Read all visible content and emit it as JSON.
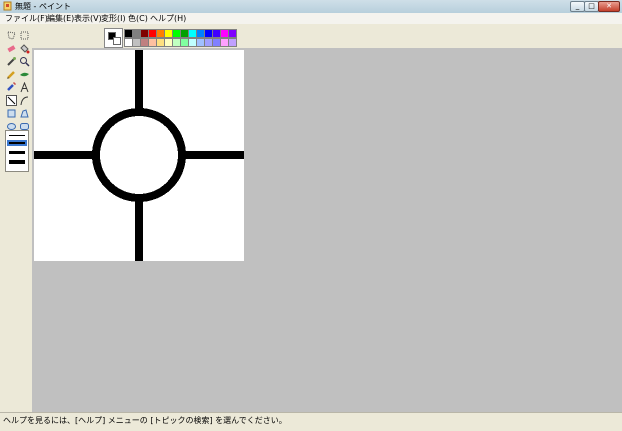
{
  "window": {
    "title": "無題 - ペイント"
  },
  "menu": [
    {
      "label": "ファイル(F)"
    },
    {
      "label": "編集(E)"
    },
    {
      "label": "表示(V)"
    },
    {
      "label": "変形(I)"
    },
    {
      "label": "色(C)"
    },
    {
      "label": "ヘルプ(H)"
    }
  ],
  "toolbox": {
    "tools": [
      "free-select",
      "rect-select",
      "eraser",
      "fill",
      "color-picker",
      "magnifier",
      "pencil",
      "brush",
      "airbrush",
      "text",
      "line",
      "curve",
      "rectangle",
      "polygon",
      "ellipse",
      "rounded-rectangle"
    ],
    "selected": "line",
    "line_widths": 4
  },
  "palette": {
    "foreground": "#000000",
    "background": "#ffffff",
    "top_row": [
      "#000000",
      "#808080",
      "#800000",
      "#808000",
      "#008000",
      "#008080",
      "#000080",
      "#800080",
      "#808040",
      "#004040",
      "#0080ff",
      "#004080",
      "#8000ff",
      "#804000"
    ],
    "colors_row1": [
      "#000000",
      "#808080",
      "#800000",
      "#ff0000",
      "#ff8000",
      "#ffff00",
      "#00ff00",
      "#00a000",
      "#00ffff",
      "#0080ff",
      "#0000ff",
      "#4000ff",
      "#ff00ff",
      "#8000ff"
    ],
    "colors_row2": [
      "#ffffff",
      "#c0c0c0",
      "#c08080",
      "#ffc0a0",
      "#ffe080",
      "#ffffc0",
      "#c0ffc0",
      "#80ffa0",
      "#c0ffff",
      "#a0c0ff",
      "#a0a0ff",
      "#8080ff",
      "#ffa0ff",
      "#c0a0ff"
    ]
  },
  "status": {
    "text": "ヘルプを見るには、[ヘルプ] メニューの [トピックの検索] を選んでください。"
  }
}
